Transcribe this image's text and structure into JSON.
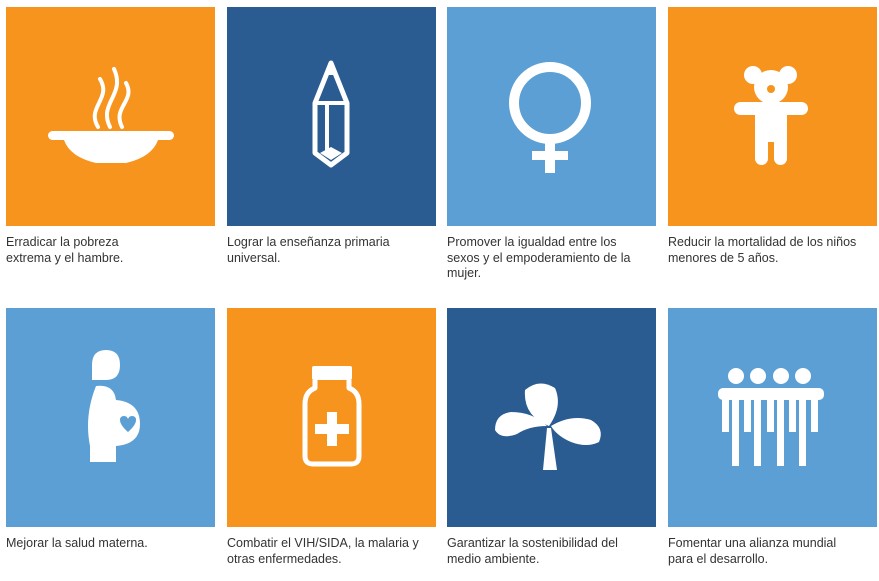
{
  "colors": {
    "orange": "#F7941D",
    "dark_blue": "#2A5C91",
    "light_blue": "#5B9FD4",
    "icon": "#FFFFFF"
  },
  "goals": [
    {
      "icon": "soup-bowl-icon",
      "color": "#F7941D",
      "caption": "Erradicar la pobreza extrema y el hambre."
    },
    {
      "icon": "pencil-icon",
      "color": "#2A5C91",
      "caption": "Lograr la enseñanza primaria universal."
    },
    {
      "icon": "venus-symbol-icon",
      "color": "#5B9FD4",
      "caption": "Promover la igualdad entre los sexos y el empoderamiento de la mujer."
    },
    {
      "icon": "teddy-bear-icon",
      "color": "#F7941D",
      "caption": "Reducir la mortalidad de los niños menores de 5 años."
    },
    {
      "icon": "pregnant-woman-icon",
      "color": "#5B9FD4",
      "caption": "Mejorar la salud materna."
    },
    {
      "icon": "medicine-bottle-icon",
      "color": "#F7941D",
      "caption": "Combatir el VIH/SIDA, la malaria y otras enfermedades."
    },
    {
      "icon": "three-leaf-plant-icon",
      "color": "#2A5C91",
      "caption": "Garantizar la sostenibilidad del medio ambiente."
    },
    {
      "icon": "group-of-people-icon",
      "color": "#5B9FD4",
      "caption": "Fomentar una alianza mundial para el desarrollo."
    }
  ]
}
